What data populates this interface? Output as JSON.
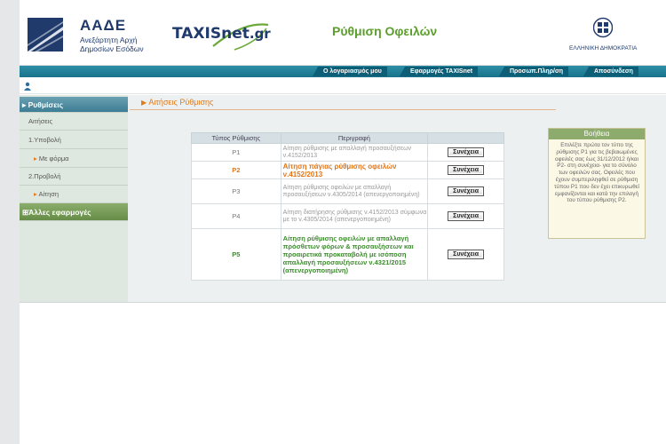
{
  "header": {
    "aade_title": "ΑΑΔΕ",
    "aade_sub1": "Ανεξάρτητη Αρχή",
    "aade_sub2": "Δημοσίων Εσόδων",
    "taxis_name": "TAXISnet",
    "taxis_suffix": ".gr",
    "page_heading": "Ρύθμιση Οφειλών",
    "gov_label": "ΕΛΛΗΝΙΚΗ ΔΗΜΟΚΡΑΤΙΑ"
  },
  "topmenu": {
    "my_account": "Ο λογαριασμός μου",
    "apps": "Εφαρμογές TAXISnet",
    "personal_info": "Προσωπ.Πληρ/ση",
    "logout": "Αποσύνδεση"
  },
  "sidebar": {
    "settlements": "Ρυθμίσεις",
    "requests": "Αιτήσεις",
    "submission": "1.Υποβολή",
    "with_form": "Με φόρμα",
    "view": "2.Προβολή",
    "request": "Αίτηση",
    "other_apps": "Άλλες εφαρμογές"
  },
  "main": {
    "breadcrumb": "Αιτήσεις Ρύθμισης",
    "table": {
      "col_type": "Τύπος Ρύθμισης",
      "col_desc": "Περιγραφή",
      "continue_label": "Συνέχεια",
      "rows": [
        {
          "type": "P1",
          "desc": "Αίτηση ρύθμισης με απαλλαγή προσαυξήσεων ν.4152/2013"
        },
        {
          "type": "P2",
          "desc": "Αίτηση πάγιας ρύθμισης οφειλών ν.4152/2013"
        },
        {
          "type": "P3",
          "desc": "Αίτηση ρύθμισης οφειλών με απαλλαγή προσαυξήσεων ν.4305/2014 (απενεργοποιημένη)"
        },
        {
          "type": "P4",
          "desc": "Αίτηση διατήρησης ρύθμισης ν.4152/2013 σύμφωνα με το ν.4305/2014 (απενεργοποιημένη)"
        },
        {
          "type": "P5",
          "desc": "Αίτηση ρύθμισης οφειλών με απαλλαγή πρόσθετων φόρων & προσαυξήσεων και προαιρετικά προκαταβολή με ισόποση απαλλαγή προσαυξήσεων ν.4321/2015 (απενεργοποιημένη)"
        }
      ]
    }
  },
  "help": {
    "title": "Βοήθεια",
    "body": "Επιλέξτε πρώτα τον τύπο της ρύθμισης P1 για τις βεβαιωμένες οφειλές σας έως 31/12/2012 ή/και P2- στη συνέχεια- για το σύνολο των οφειλών σας. Οφειλές που έχουν συμπεριληφθεί σε ρύθμιση τύπου P1 που δεν έχει επικυρωθεί εμφανίζονται και κατά την επιλογή του τύπου ρύθμισης P2."
  },
  "colors": {
    "accent_teal": "#17728a",
    "orange": "#e0761a",
    "green": "#3d8a2f",
    "navy": "#1f3a6b"
  }
}
